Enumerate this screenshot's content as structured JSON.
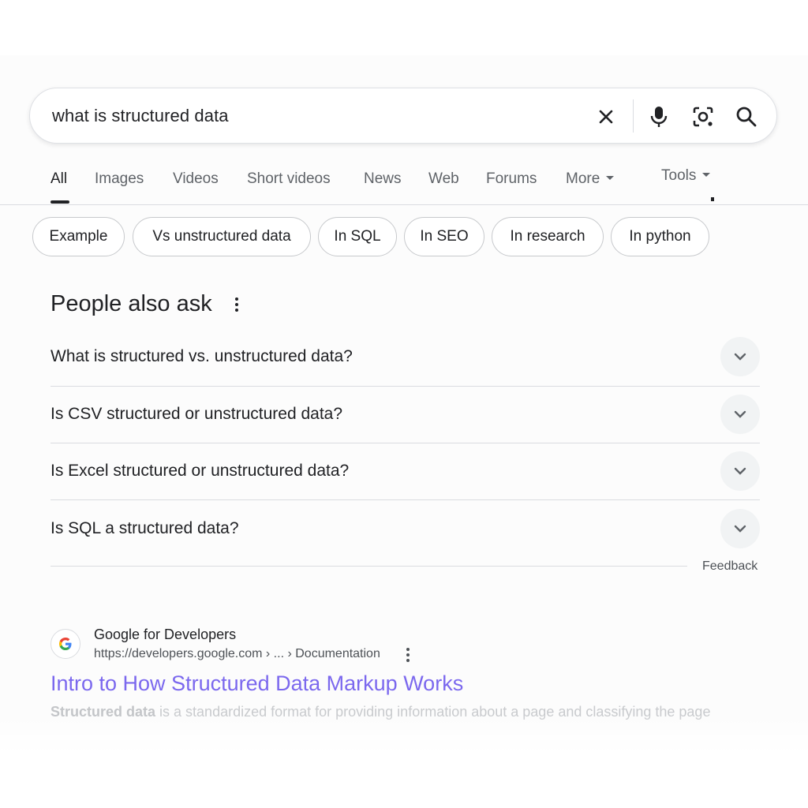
{
  "search": {
    "query": "what is structured data"
  },
  "icons": {
    "clear": "close-icon",
    "voice": "microphone-icon",
    "lens": "camera-lens-icon",
    "search": "search-icon"
  },
  "tabs": [
    {
      "label": "All",
      "active": true
    },
    {
      "label": "Images"
    },
    {
      "label": "Videos"
    },
    {
      "label": "Short videos"
    },
    {
      "label": "News"
    },
    {
      "label": "Web"
    },
    {
      "label": "Forums"
    },
    {
      "label": "More"
    }
  ],
  "tools_label": "Tools",
  "chips": [
    {
      "label": "Example"
    },
    {
      "label": "Vs unstructured data"
    },
    {
      "label": "In SQL"
    },
    {
      "label": "In SEO"
    },
    {
      "label": "In research"
    },
    {
      "label": "In python"
    }
  ],
  "people_also_ask": {
    "title": "People also ask",
    "questions": [
      "What is structured vs. unstructured data?",
      "Is CSV structured or unstructured data?",
      "Is Excel structured or unstructured data?",
      "Is SQL a structured data?"
    ],
    "feedback_label": "Feedback"
  },
  "result": {
    "site_name": "Google for Developers",
    "url": "https://developers.google.com › ... › Documentation",
    "title": "Intro to How Structured Data Markup Works",
    "snippet_bold": "Structured data",
    "snippet_rest": " is a standardized format for providing information about a page and classifying the page",
    "favicon": "google-g-icon"
  },
  "colors": {
    "link_title": "#7b68ee",
    "text_primary": "#202124",
    "text_secondary": "#5f6368"
  }
}
